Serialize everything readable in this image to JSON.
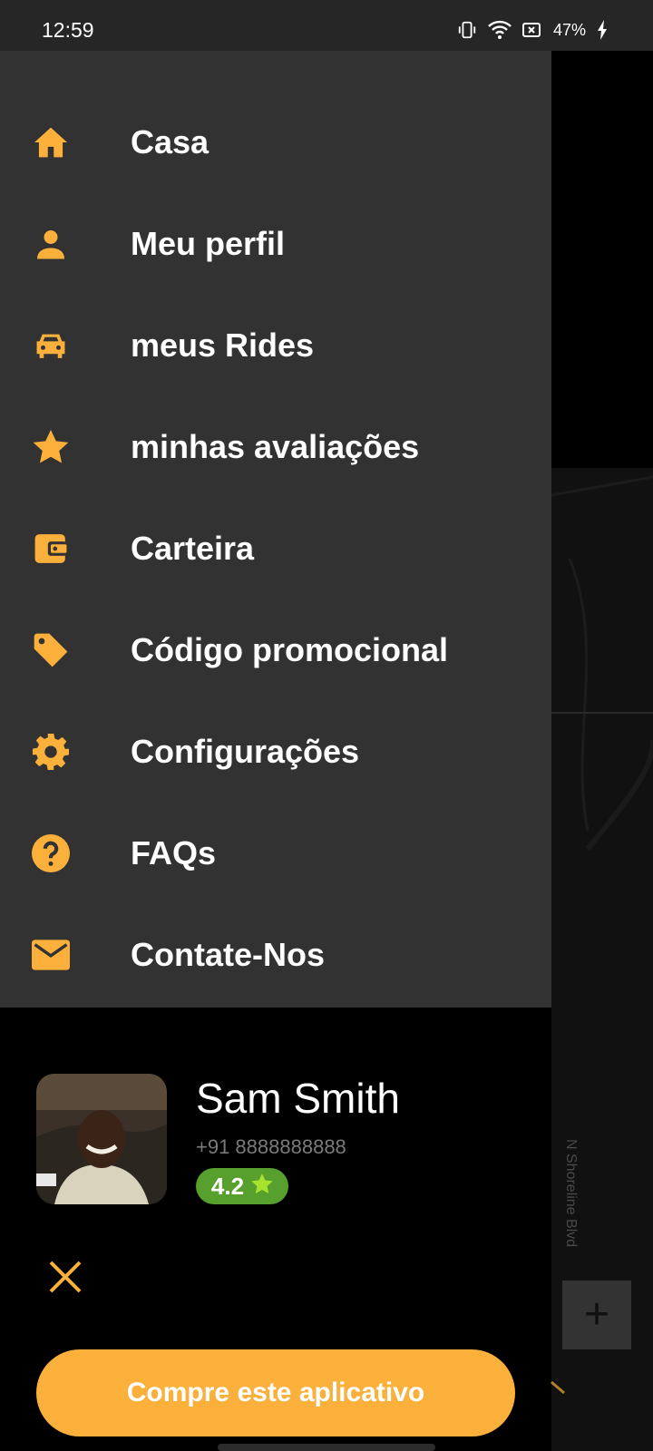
{
  "status_bar": {
    "time": "12:59",
    "battery": "47%"
  },
  "menu": {
    "items": [
      {
        "label": "Casa",
        "icon": "home-icon"
      },
      {
        "label": "Meu perfil",
        "icon": "person-icon"
      },
      {
        "label": "meus Rides",
        "icon": "car-icon"
      },
      {
        "label": "minhas avaliações",
        "icon": "star-icon"
      },
      {
        "label": "Carteira",
        "icon": "wallet-icon"
      },
      {
        "label": "Código promocional",
        "icon": "tag-icon"
      },
      {
        "label": "Configurações",
        "icon": "gear-icon"
      },
      {
        "label": "FAQs",
        "icon": "help-icon"
      },
      {
        "label": "Contate-Nos",
        "icon": "mail-icon"
      }
    ]
  },
  "profile": {
    "name": "Sam Smith",
    "phone": "+91 8888888888",
    "rating": "4.2"
  },
  "map": {
    "road_label": "N Shoreline Blvd"
  },
  "buy_button": {
    "label": "Compre este aplicativo"
  },
  "colors": {
    "accent": "#fbb03b",
    "drawer": "#323232",
    "rating_green": "#57a02d"
  }
}
